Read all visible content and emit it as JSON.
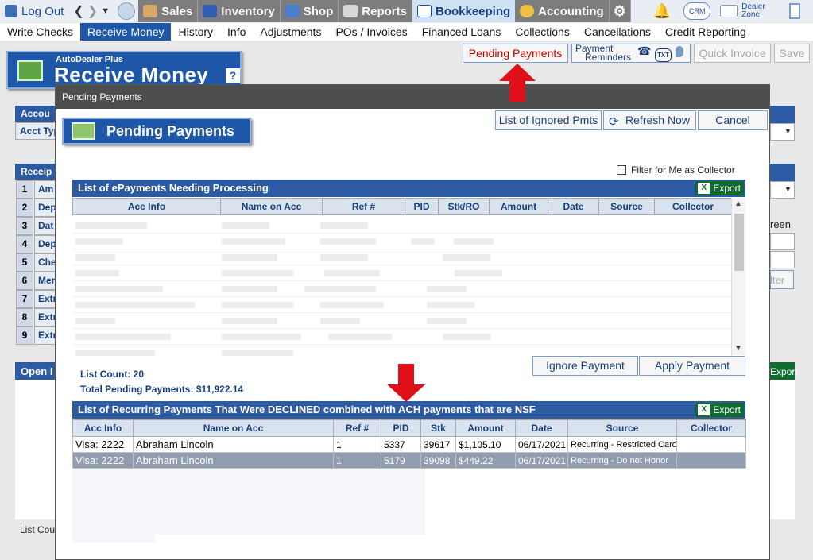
{
  "topnav": {
    "logout": "Log Out",
    "tabs": [
      {
        "label": "Sales",
        "icon": "salesperson-icon"
      },
      {
        "label": "Inventory",
        "icon": "car-icon"
      },
      {
        "label": "Shop",
        "icon": "wrench-icon"
      },
      {
        "label": "Reports",
        "icon": "report-icon"
      },
      {
        "label": "Bookkeeping",
        "icon": "book-icon"
      },
      {
        "label": "Accounting",
        "icon": "pie-chart-icon"
      }
    ],
    "crm": "CRM",
    "dealer_zone_line1": "Dealer",
    "dealer_zone_line2": "Zone"
  },
  "subnav": {
    "items": [
      "Write Checks",
      "Receive Money",
      "History",
      "Info",
      "Adjustments",
      "POs / Invoices",
      "Financed Loans",
      "Collections",
      "Cancellations",
      "Credit Reporting"
    ],
    "active_index": 1
  },
  "header": {
    "brand": "AutoDealer Plus",
    "title": "Receive Money",
    "help": "?"
  },
  "toolbar": {
    "pending_payments": "Pending Payments",
    "payment_reminders_line1": "Payment",
    "payment_reminders_line2": "Reminders",
    "txt": "TXT",
    "quick_invoice": "Quick Invoice",
    "save": "Save"
  },
  "background": {
    "account_label": "Accou",
    "acct_type_label": "Acct Typ",
    "receipts_label": "Receip",
    "rows": [
      {
        "num": "1",
        "label": "Am"
      },
      {
        "num": "2",
        "label": "Dep"
      },
      {
        "num": "3",
        "label": "Dat"
      },
      {
        "num": "4",
        "label": "Dep"
      },
      {
        "num": "5",
        "label": "Che"
      },
      {
        "num": "6",
        "label": "Mer"
      },
      {
        "num": "7",
        "label": "Extr"
      },
      {
        "num": "8",
        "label": "Extr"
      },
      {
        "num": "9",
        "label": "Extr"
      }
    ],
    "open_label": "Open I",
    "list_count_label": "List Cou",
    "right_reen": "reen",
    "right_filter": "lter",
    "right_export": "Export"
  },
  "modal": {
    "title": "Pending Payments",
    "badge": "Pending Payments",
    "buttons": {
      "list_ignored": "List of Ignored Pmts",
      "refresh": "Refresh Now",
      "cancel": "Cancel"
    },
    "filter_label": "Filter for Me as Collector",
    "epayments": {
      "title": "List of ePayments Needing Processing",
      "export": "Export",
      "columns": [
        "Acc Info",
        "Name on Acc",
        "Ref #",
        "PID",
        "Stk/RO",
        "Amount",
        "Date",
        "Source",
        "Collector"
      ]
    },
    "list_count": "List Count: 20",
    "total_pending": "Total Pending Payments: $11,922.14",
    "ignore_payment": "Ignore Payment",
    "apply_payment": "Apply Payment",
    "declined": {
      "title": "List of Recurring Payments That Were DECLINED combined with ACH payments that are NSF",
      "export": "Export",
      "columns": [
        "Acc Info",
        "Name on Acc",
        "Ref #",
        "PID",
        "Stk",
        "Amount",
        "Date",
        "Source",
        "Collector"
      ],
      "rows": [
        {
          "acc": "Visa: 2222",
          "name": "Abraham Lincoln",
          "ref": "1",
          "pid": "5337",
          "stk": "39617",
          "amount": "$1,105.10",
          "date": "06/17/2021",
          "source": "Recurring - Restricted Card",
          "collector": ""
        },
        {
          "acc": "Visa: 2222",
          "name": "Abraham Lincoln",
          "ref": "1",
          "pid": "5179",
          "stk": "39098",
          "amount": "$449.22",
          "date": "06/17/2021",
          "source": "Recurring - Do not Honor",
          "collector": ""
        }
      ]
    }
  },
  "colors": {
    "brand_blue": "#1e57a8",
    "section_blue": "#2c5aa3",
    "alert_red": "#e0101a",
    "export_green": "#0f6b2e"
  }
}
